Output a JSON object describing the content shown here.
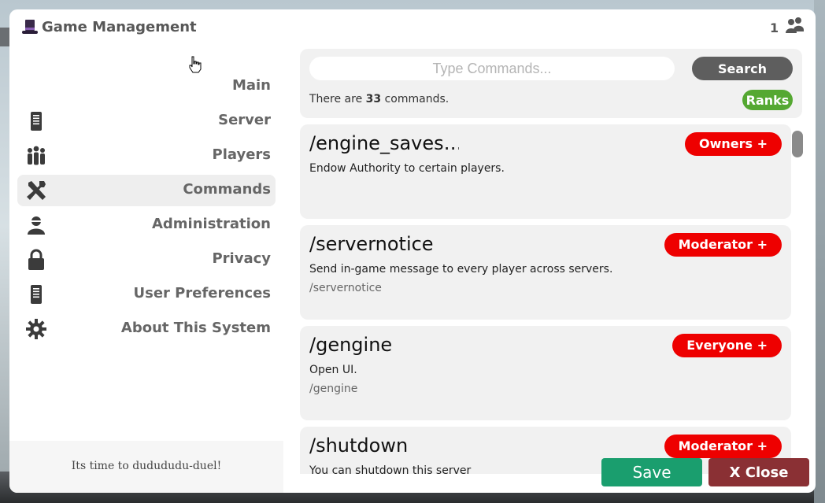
{
  "window": {
    "title": "Game Management",
    "player_count": "1",
    "icons": {
      "title": "top-hat-icon",
      "players": "people-icon"
    }
  },
  "sidebar": {
    "items": [
      {
        "label": "Main",
        "icon": "",
        "active": false
      },
      {
        "label": "Server",
        "icon": "server-icon",
        "active": false
      },
      {
        "label": "Players",
        "icon": "players-icon",
        "active": false
      },
      {
        "label": "Commands",
        "icon": "tools-icon",
        "active": true
      },
      {
        "label": "Administration",
        "icon": "admin-icon",
        "active": false
      },
      {
        "label": "Privacy",
        "icon": "lock-icon",
        "active": false
      },
      {
        "label": "User Preferences",
        "icon": "preferences-icon",
        "active": false
      },
      {
        "label": "About This System",
        "icon": "gear-icon",
        "active": false
      }
    ],
    "footer": "Its time to dudududu-duel!"
  },
  "search": {
    "placeholder": "Type Commands...",
    "button_label": "Search",
    "count_prefix": "There are ",
    "count": "33",
    "count_suffix": " commands.",
    "ranks_label": "Ranks"
  },
  "commands": [
    {
      "name": "/engine_saves…",
      "description": "Endow Authority to certain players.",
      "usage": "",
      "rank": "Owners +"
    },
    {
      "name": "/servernotice",
      "description": "Send in-game message to every player across servers.",
      "usage": "/servernotice",
      "rank": "Moderator +"
    },
    {
      "name": "/gengine",
      "description": "Open UI.",
      "usage": "/gengine",
      "rank": "Everyone +"
    },
    {
      "name": "/shutdown",
      "description": "You can shutdown this server",
      "usage": "",
      "rank": "Moderator +"
    }
  ],
  "actions": {
    "save_label": "Save",
    "close_label": "X  Close"
  },
  "colors": {
    "accent_red": "#ee0000",
    "search_gray": "#5e5e5e",
    "ranks_green": "#55a832",
    "save_green": "#1a9e6e",
    "close_red": "#8a3034"
  }
}
